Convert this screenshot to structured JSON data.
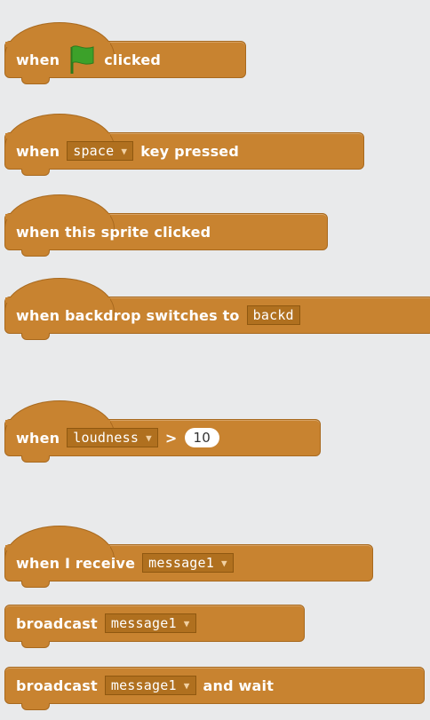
{
  "blocks": {
    "when_flag": {
      "part1": "when",
      "part2": "clicked",
      "flag_color": "#3ca12a"
    },
    "when_key": {
      "part1": "when",
      "dropdown": "space",
      "part2": "key pressed"
    },
    "sprite_clicked": {
      "label": "when this sprite clicked"
    },
    "backdrop": {
      "part1": "when backdrop switches to",
      "dropdown": "backd"
    },
    "loudness": {
      "part1": "when",
      "dropdown": "loudness",
      "op": ">",
      "value": "10"
    },
    "receive": {
      "part1": "when I receive",
      "dropdown": "message1"
    },
    "broadcast": {
      "part1": "broadcast",
      "dropdown": "message1"
    },
    "broadcast_wait": {
      "part1": "broadcast",
      "dropdown": "message1",
      "part2": "and wait"
    }
  },
  "colors": {
    "events": "#c88330",
    "background": "#e9eaeb"
  }
}
